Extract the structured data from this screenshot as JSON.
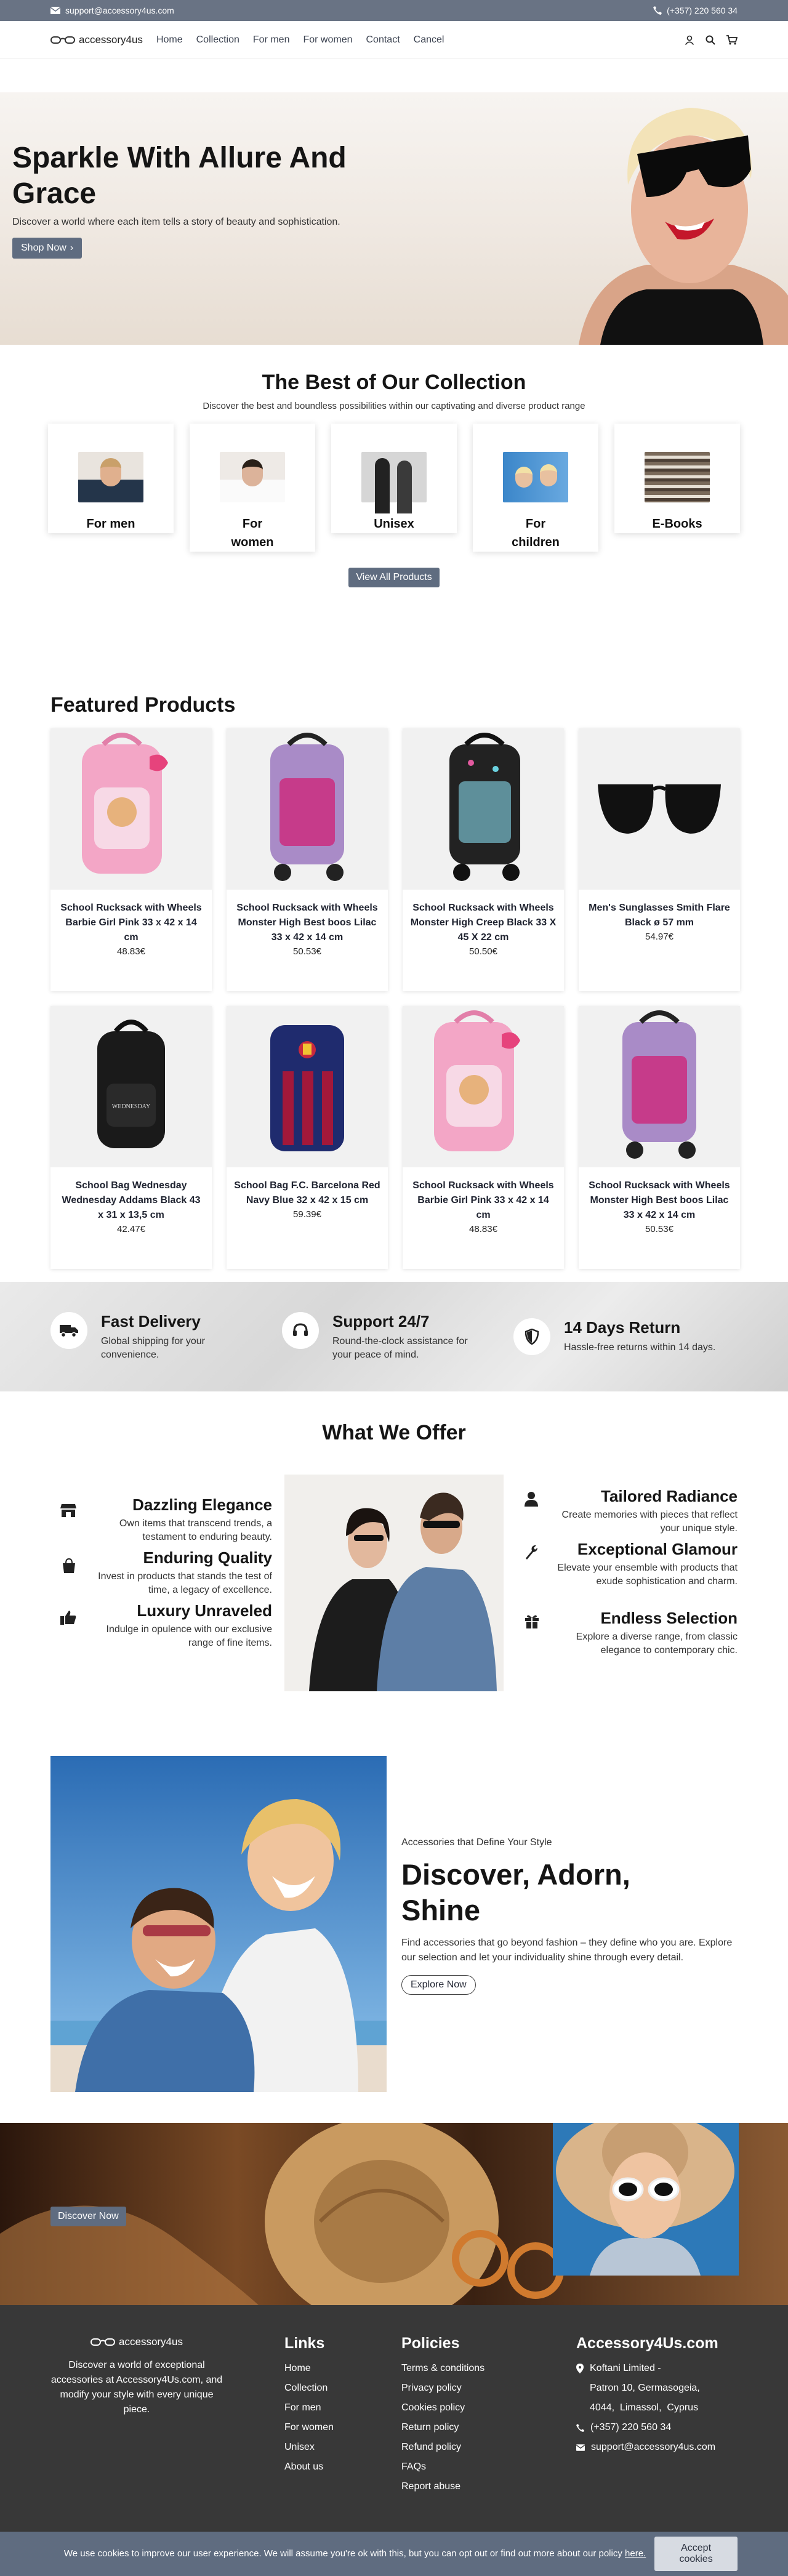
{
  "topbar": {
    "email": "support@accessory4us.com",
    "phone": "(+357) 220 560 34"
  },
  "nav": {
    "logo": "accessory4us",
    "items": [
      "Home",
      "Collection",
      "For men",
      "For women",
      "Contact",
      "Cancel"
    ]
  },
  "hero": {
    "title": "Sparkle With Allure And Grace",
    "subtitle": "Discover a world where each item tells a story of beauty and sophistication.",
    "cta": "Shop Now"
  },
  "collection": {
    "title": "The Best of Our Collection",
    "subtitle": "Discover the best and boundless possibilities within our captivating and diverse product range",
    "categories": [
      "For men",
      "For women",
      "Unisex",
      "For children",
      "E-Books"
    ],
    "view_all": "View All Products"
  },
  "featured": {
    "title": "Featured Products",
    "products": [
      {
        "name": "School Rucksack with Wheels Barbie Girl Pink 33 x 42 x 14 cm",
        "price": "48.83€"
      },
      {
        "name": "School Rucksack with Wheels Monster High Best boos Lilac 33 x 42 x 14 cm",
        "price": "50.53€"
      },
      {
        "name": "School Rucksack with Wheels Monster High Creep Black 33 X 45 X 22 cm",
        "price": "50.50€"
      },
      {
        "name": "Men's Sunglasses Smith Flare Black ø 57 mm",
        "price": "54.97€"
      },
      {
        "name": "School Bag Wednesday Wednesday Addams Black 43 x 31 x 13,5 cm",
        "price": "42.47€"
      },
      {
        "name": "School Bag F.C. Barcelona Red Navy Blue 32 x 42 x 15 cm",
        "price": "59.39€"
      },
      {
        "name": "School Rucksack with Wheels Barbie Girl Pink 33 x 42 x 14 cm",
        "price": "48.83€"
      },
      {
        "name": "School Rucksack with Wheels Monster High Best boos Lilac 33 x 42 x 14 cm",
        "price": "50.53€"
      }
    ]
  },
  "features": [
    {
      "title": "Fast Delivery",
      "desc": "Global shipping for your convenience.",
      "icon": "truck-icon"
    },
    {
      "title": "Support 24/7",
      "desc": "Round-the-clock assistance for your peace of mind.",
      "icon": "headset-icon"
    },
    {
      "title": "14 Days Return",
      "desc": "Hassle-free returns within 14 days.",
      "icon": "shield-icon"
    }
  ],
  "offer": {
    "title": "What We Offer",
    "left": [
      {
        "title": "Dazzling Elegance",
        "desc": "Own items that transcend trends, a testament to enduring beauty."
      },
      {
        "title": "Enduring Quality",
        "desc": "Invest in products that stands the test of time, a legacy of excellence."
      },
      {
        "title": "Luxury Unraveled",
        "desc": "Indulge in opulence with our exclusive range of fine items."
      }
    ],
    "right": [
      {
        "title": "Tailored Radiance",
        "desc": "Create memories with pieces that reflect your unique style."
      },
      {
        "title": "Exceptional Glamour",
        "desc": "Elevate your ensemble with products that exude sophistication and charm."
      },
      {
        "title": "Endless Selection",
        "desc": "Explore a diverse range, from classic elegance to contemporary chic."
      }
    ]
  },
  "discover": {
    "eyebrow": "Accessories that Define Your Style",
    "title": "Discover, Adorn, Shine",
    "desc": "Find accessories that go beyond fashion – they define who you are. Explore our selection and let your individuality shine through every detail.",
    "cta": "Explore Now"
  },
  "banner": {
    "cta": "Discover Now"
  },
  "footer": {
    "logo": "accessory4us",
    "about": "Discover a world of exceptional accessories at Accessory4Us.com, and modify your style with every unique piece.",
    "links_title": "Links",
    "links": [
      "Home",
      "Collection",
      "For men",
      "For women",
      "Unisex",
      "About us"
    ],
    "policies_title": "Policies",
    "policies": [
      "Terms & conditions",
      "Privacy policy",
      "Cookies policy",
      "Return policy",
      "Refund policy",
      "FAQs",
      "Report abuse"
    ],
    "contact_title": "Accessory4Us.com",
    "address": [
      "Koftani Limited -",
      "Patron 10, Germasogeia,",
      "4044,  Limassol,  Cyprus"
    ],
    "phone": "(+357) 220 560 34",
    "email": "support@accessory4us.com"
  },
  "cookie": {
    "text": "We use cookies to improve our user experience. We will assume you're ok with this, but you can opt out or find out more about our policy ",
    "link": "here.",
    "button": "Accept cookies"
  }
}
